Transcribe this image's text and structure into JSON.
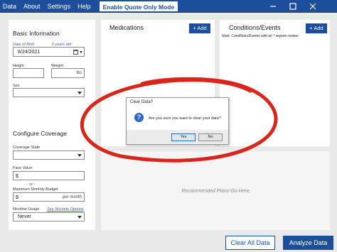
{
  "menu": {
    "items": [
      "Data",
      "About",
      "Settings",
      "Help"
    ],
    "quote_button": "Enable Quote Only Mode"
  },
  "window_controls": {
    "minimize": "minimize-icon",
    "maximize": "maximize-icon",
    "close": "close-icon"
  },
  "basic_info": {
    "title": "Basic Information",
    "dob_label": "Date of Birth",
    "age_text": "0 years old",
    "dob_value": "8/24/2021",
    "height_label": "Height",
    "weight_label": "Weight",
    "weight_unit": "lbs",
    "sex_label": "Sex"
  },
  "coverage": {
    "title": "Configure Coverage",
    "state_label": "Coverage State",
    "face_label": "Face Value",
    "face_prefix": "$",
    "or_text": "- or -",
    "budget_label": "Maximum Monthly Budget",
    "budget_prefix": "$",
    "budget_unit": "per month",
    "nicotine_label": "Nicotine Usage",
    "nicotine_link": "See Nicotine Options",
    "nicotine_value": "Never"
  },
  "medications": {
    "title": "Medications",
    "add_label": "+ Add"
  },
  "conditions": {
    "title": "Conditions/Events",
    "add_label": "+ Add",
    "note": "Note: Conditions/Events with an * require review."
  },
  "plans": {
    "placeholder": "Recommended Plans Go Here"
  },
  "actions": {
    "clear_all": "Clear All Data",
    "analyze": "Analyze Data"
  },
  "dialog": {
    "title": "Clear Data?",
    "message": "Are you sure you want to clear your data?",
    "icon": "question-icon",
    "icon_glyph": "?",
    "yes": "Yes",
    "no": "No"
  },
  "colors": {
    "brand": "#1d4e9c",
    "annotation": "#d9261c"
  }
}
